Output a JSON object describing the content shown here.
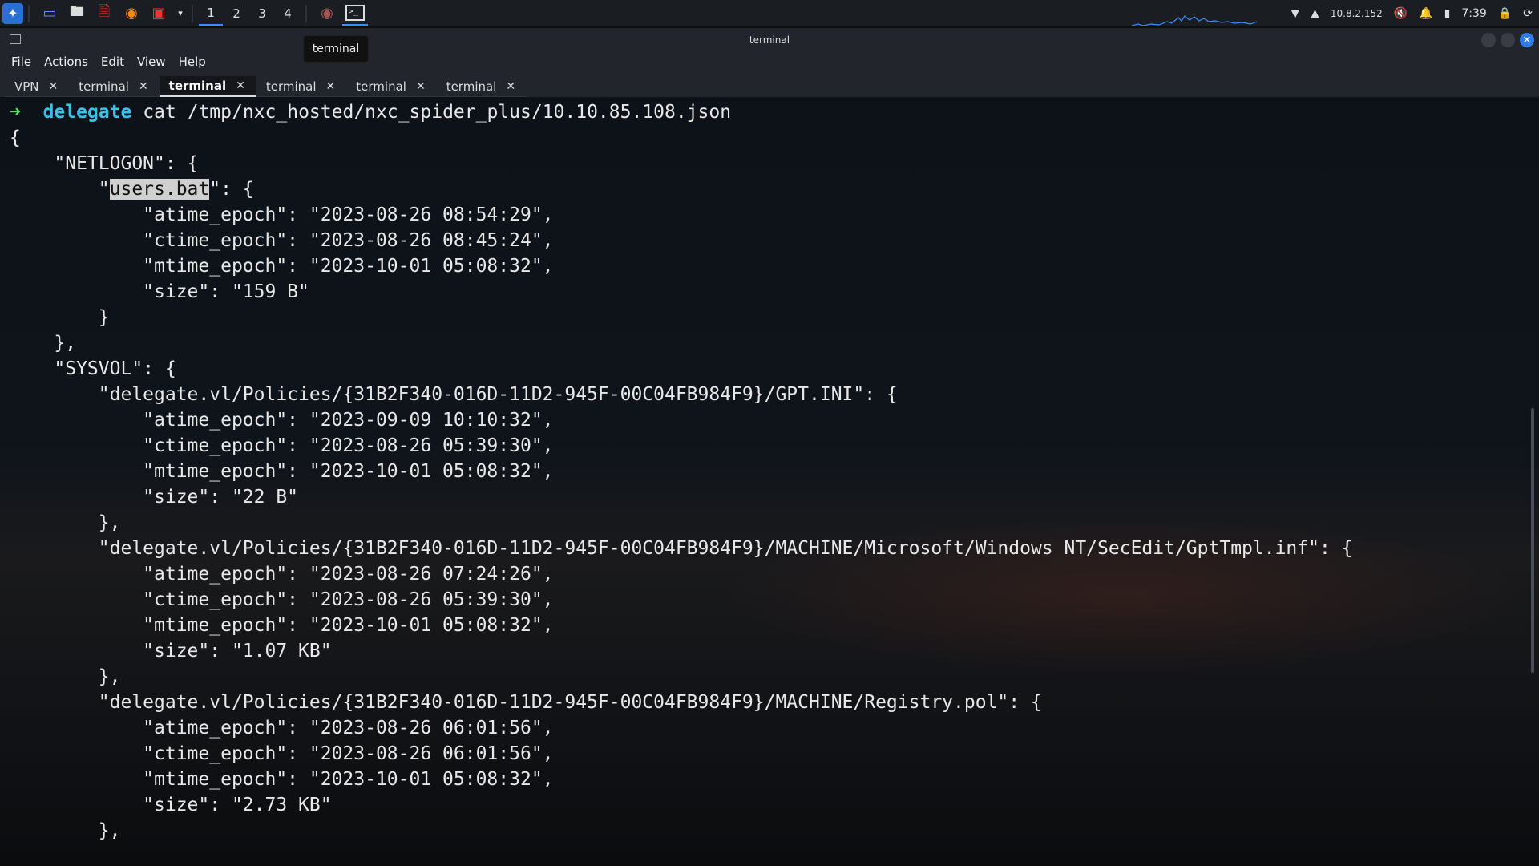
{
  "panel": {
    "workspaces": [
      "1",
      "2",
      "3",
      "4"
    ],
    "active_workspace": "1",
    "tray": {
      "ip": "10.8.2.152",
      "time": "7:39"
    }
  },
  "tooltip": "terminal",
  "window": {
    "title": "terminal",
    "menu": [
      "File",
      "Actions",
      "Edit",
      "View",
      "Help"
    ],
    "tabs": [
      {
        "label": "VPN"
      },
      {
        "label": "terminal"
      },
      {
        "label": "terminal",
        "active": true
      },
      {
        "label": "terminal"
      },
      {
        "label": "terminal"
      },
      {
        "label": "terminal"
      }
    ]
  },
  "terminal": {
    "prompt_dir": "delegate",
    "command": "cat /tmp/nxc_hosted/nxc_spider_plus/10.10.85.108.json",
    "lines": [
      "{",
      "    \"NETLOGON\": {",
      "        \"",
      "users.bat",
      "\": {",
      "            \"atime_epoch\": \"2023-08-26 08:54:29\",",
      "            \"ctime_epoch\": \"2023-08-26 08:45:24\",",
      "            \"mtime_epoch\": \"2023-10-01 05:08:32\",",
      "            \"size\": \"159 B\"",
      "        }",
      "    },",
      "    \"SYSVOL\": {",
      "        \"delegate.vl/Policies/{31B2F340-016D-11D2-945F-00C04FB984F9}/GPT.INI\": {",
      "            \"atime_epoch\": \"2023-09-09 10:10:32\",",
      "            \"ctime_epoch\": \"2023-08-26 05:39:30\",",
      "            \"mtime_epoch\": \"2023-10-01 05:08:32\",",
      "            \"size\": \"22 B\"",
      "        },",
      "        \"delegate.vl/Policies/{31B2F340-016D-11D2-945F-00C04FB984F9}/MACHINE/Microsoft/Windows NT/SecEdit/GptTmpl.inf\": {",
      "            \"atime_epoch\": \"2023-08-26 07:24:26\",",
      "            \"ctime_epoch\": \"2023-08-26 05:39:30\",",
      "            \"mtime_epoch\": \"2023-10-01 05:08:32\",",
      "            \"size\": \"1.07 KB\"",
      "        },",
      "        \"delegate.vl/Policies/{31B2F340-016D-11D2-945F-00C04FB984F9}/MACHINE/Registry.pol\": {",
      "            \"atime_epoch\": \"2023-08-26 06:01:56\",",
      "            \"ctime_epoch\": \"2023-08-26 06:01:56\",",
      "            \"mtime_epoch\": \"2023-10-01 05:08:32\",",
      "            \"size\": \"2.73 KB\"",
      "        },"
    ]
  },
  "colors": {
    "accent": "#3c8cff",
    "prompt_arrow": "#4ee66a",
    "prompt_dir": "#37c3e9"
  }
}
